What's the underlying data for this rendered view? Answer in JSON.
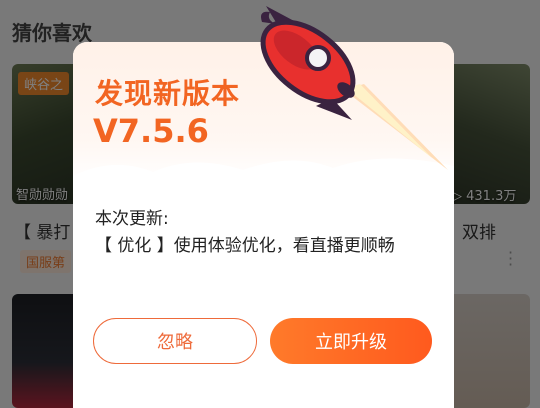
{
  "feed": {
    "section_title": "猜你喜欢",
    "card_left": {
      "tag": "峡谷之",
      "caption": "智勋勋勋",
      "title": "【 暴打",
      "badge": "国服第"
    },
    "card_right": {
      "views": "431.3万",
      "title": "双排"
    }
  },
  "dialog": {
    "title": "发现新版本",
    "version": "V7.5.6",
    "notes_label": "本次更新:",
    "notes_body": "【 优化 】使用体验优化，看直播更顺畅",
    "ignore_label": "忽略",
    "upgrade_label": "立即升级",
    "icon": "rocket-icon"
  },
  "colors": {
    "accent": "#f26522",
    "button_gradient_start": "#ff7a2a",
    "button_gradient_end": "#ff5a1e",
    "overlay": "rgba(0,0,0,0.5)"
  }
}
